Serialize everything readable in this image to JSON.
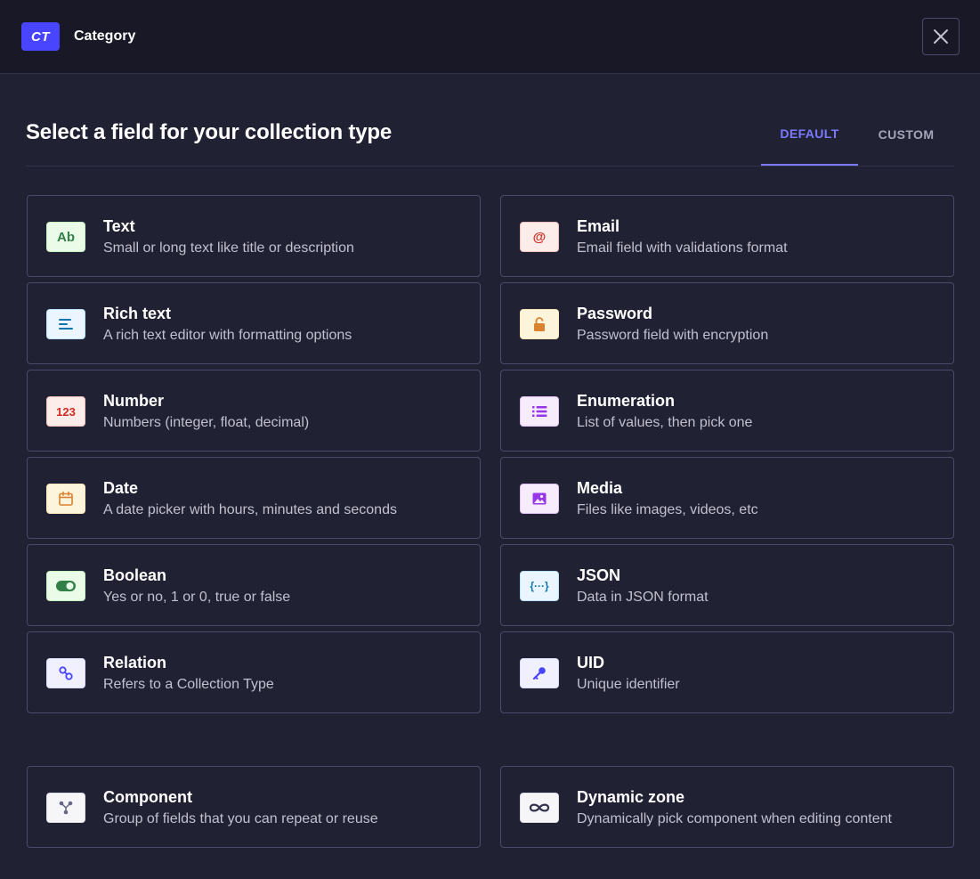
{
  "header": {
    "badge": "CT",
    "title": "Category"
  },
  "page_title": "Select a field for your collection type",
  "tabs": [
    {
      "label": "DEFAULT",
      "active": true
    },
    {
      "label": "CUSTOM",
      "active": false
    }
  ],
  "fields": [
    {
      "title": "Text",
      "desc": "Small or long text like title or description",
      "icon": "text-icon",
      "icon_text": "Ab"
    },
    {
      "title": "Email",
      "desc": "Email field with validations format",
      "icon": "email-icon",
      "icon_text": "@"
    },
    {
      "title": "Rich text",
      "desc": "A rich text editor with formatting options",
      "icon": "rich-text-icon"
    },
    {
      "title": "Password",
      "desc": "Password field with encryption",
      "icon": "lock-icon"
    },
    {
      "title": "Number",
      "desc": "Numbers (integer, float, decimal)",
      "icon": "number-icon",
      "icon_text": "123"
    },
    {
      "title": "Enumeration",
      "desc": "List of values, then pick one",
      "icon": "list-icon"
    },
    {
      "title": "Date",
      "desc": "A date picker with hours, minutes and seconds",
      "icon": "calendar-icon"
    },
    {
      "title": "Media",
      "desc": "Files like images, videos, etc",
      "icon": "media-icon"
    },
    {
      "title": "Boolean",
      "desc": "Yes or no, 1 or 0, true or false",
      "icon": "toggle-icon"
    },
    {
      "title": "JSON",
      "desc": "Data in JSON format",
      "icon": "json-icon",
      "icon_text": "{···}"
    },
    {
      "title": "Relation",
      "desc": "Refers to a Collection Type",
      "icon": "relation-icon"
    },
    {
      "title": "UID",
      "desc": "Unique identifier",
      "icon": "key-icon"
    }
  ],
  "extras": [
    {
      "title": "Component",
      "desc": "Group of fields that you can repeat or reuse",
      "icon": "component-icon"
    },
    {
      "title": "Dynamic zone",
      "desc": "Dynamically pick component when editing content",
      "icon": "infinity-icon"
    }
  ],
  "colors": {
    "accent": "#4945ff",
    "active_tab": "#7b79ff",
    "background": "#212134",
    "header_background": "#181826"
  }
}
